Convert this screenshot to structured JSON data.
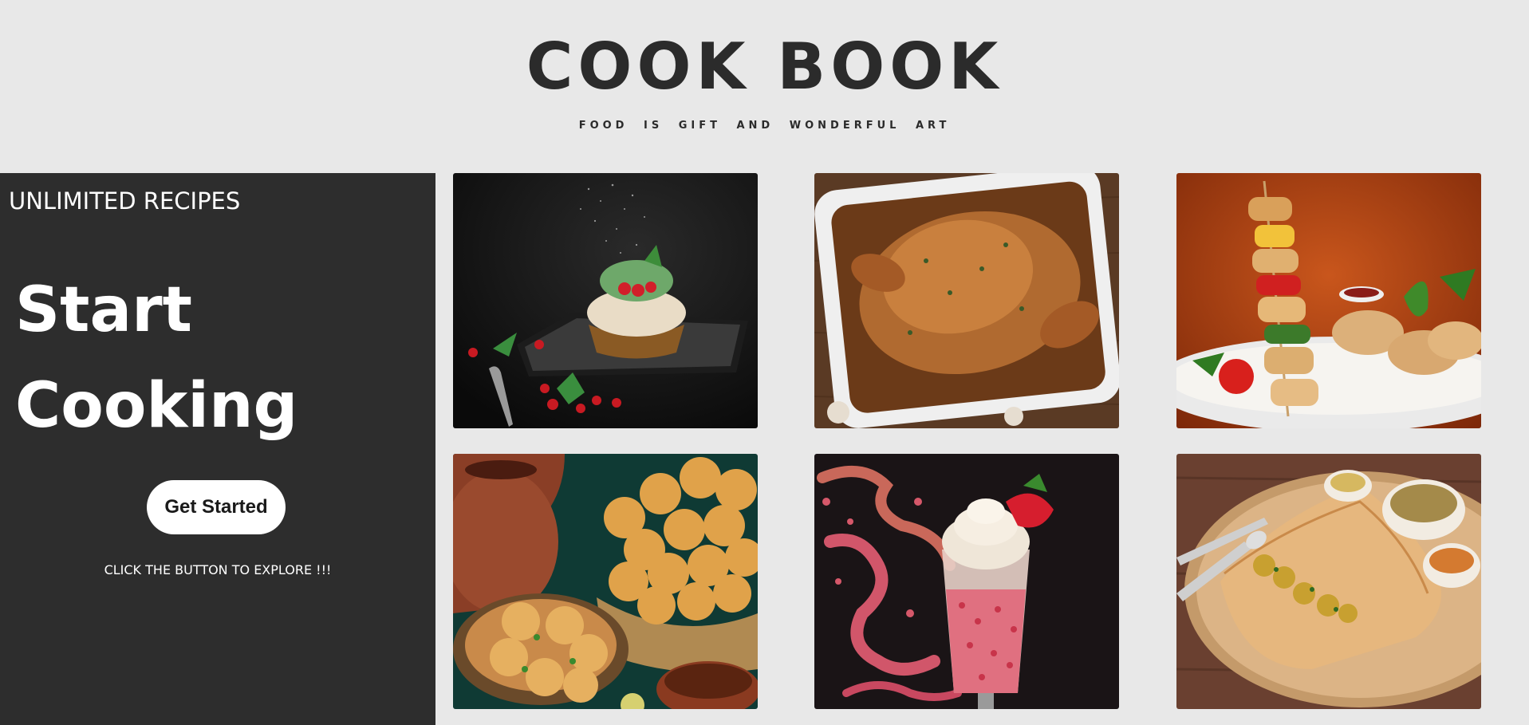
{
  "header": {
    "title": "COOK BOOK",
    "tagline": "FOOD IS GIFT AND WONDERFUL ART"
  },
  "hero": {
    "eyebrow": "UNLIMITED RECIPES",
    "heading_line1": "Start",
    "heading_line2": "Cooking",
    "cta_label": "Get Started",
    "cta_hint": "CLICK THE BUTTON TO EXPLORE !!!"
  },
  "colors": {
    "page_background": "#e8e8e8",
    "panel_background": "#2d2d2d",
    "title_text": "#2b2b2b",
    "button_background": "#ffffff"
  },
  "gallery": {
    "tiles": [
      {
        "name": "dessert-tart-image"
      },
      {
        "name": "roast-chicken-image"
      },
      {
        "name": "chicken-skewers-image"
      },
      {
        "name": "pani-puri-image"
      },
      {
        "name": "strawberry-milkshake-image"
      },
      {
        "name": "dosa-image"
      }
    ]
  }
}
